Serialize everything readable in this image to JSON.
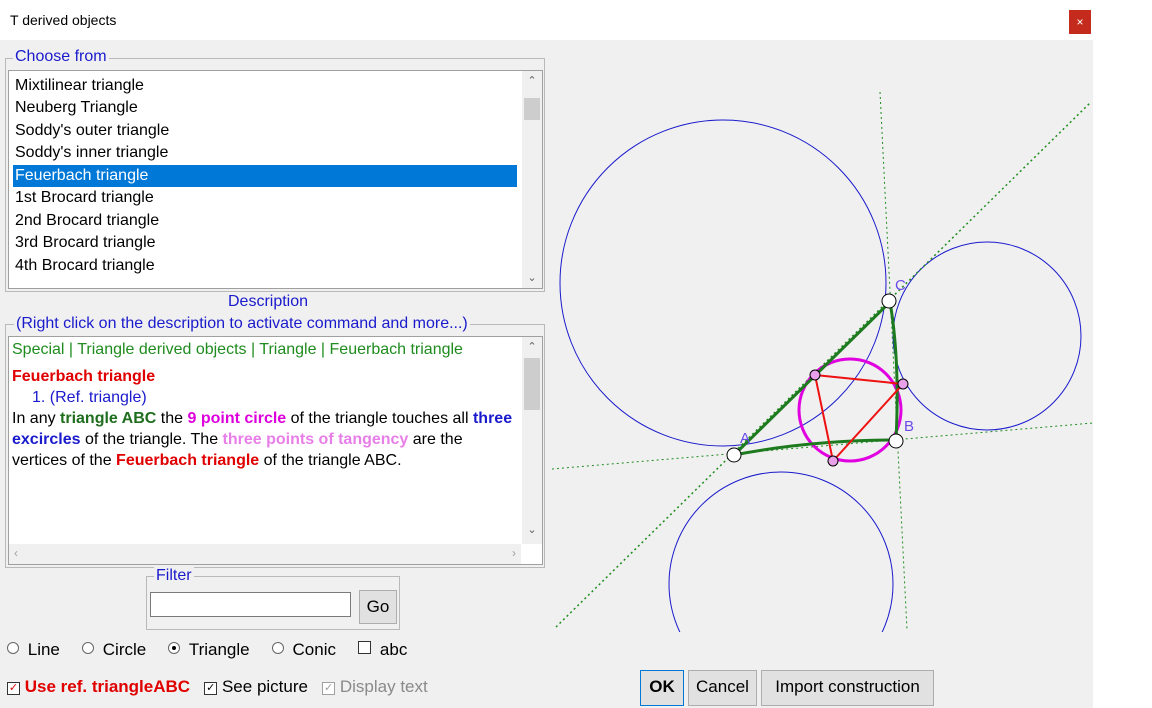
{
  "window": {
    "title": "T derived objects",
    "close_glyph": "×"
  },
  "choose": {
    "legend": "Choose from",
    "items": [
      "Mixtilinear triangle",
      "Neuberg Triangle",
      "Soddy's outer triangle",
      "Soddy's inner triangle",
      "Feuerbach triangle",
      "1st Brocard triangle",
      "2nd Brocard triangle",
      "3rd Brocard triangle",
      "4th Brocard triangle"
    ],
    "selected": "Feuerbach triangle"
  },
  "description": {
    "label": "Description",
    "hint": "(Right click on the description to activate command and more...)",
    "breadcrumb": "Special | Triangle derived objects | Triangle | Feuerbach triangle",
    "heading": "Feuerbach triangle",
    "ref": "1.  (Ref. triangle)",
    "body": {
      "t1": "In any ",
      "t2": "triangle ABC",
      "t3": " the ",
      "t4": "9 point circle",
      "t5": " of the triangle touches all ",
      "t6": "three excircles",
      "t7": " of the triangle. The ",
      "t8": "three points of tangency",
      "t9": " are the vertices of the ",
      "t10": "Feuerbach triangle",
      "t11": " of the triangle ABC."
    }
  },
  "filter": {
    "legend": "Filter",
    "value": "",
    "go_label": "Go"
  },
  "options": {
    "line": "Line",
    "circle": "Circle",
    "triangle": "Triangle",
    "conic": "Conic",
    "abc": "abc",
    "selected": "Triangle",
    "use_ref": "Use ref. triangleABC",
    "see_picture": "See picture",
    "display_text": "Display text"
  },
  "buttons": {
    "ok": "OK",
    "cancel": "Cancel",
    "import": "Import construction"
  },
  "figure": {
    "label_a": "A",
    "label_b": "B",
    "label_c": "C"
  },
  "colors": {
    "accent_blue": "#1a1acd",
    "selection": "#0078d7",
    "green": "#1e8c1e",
    "red": "#e00000",
    "magenta": "#dd00dd",
    "pink": "#e87ee8",
    "close": "#c42b1c"
  }
}
